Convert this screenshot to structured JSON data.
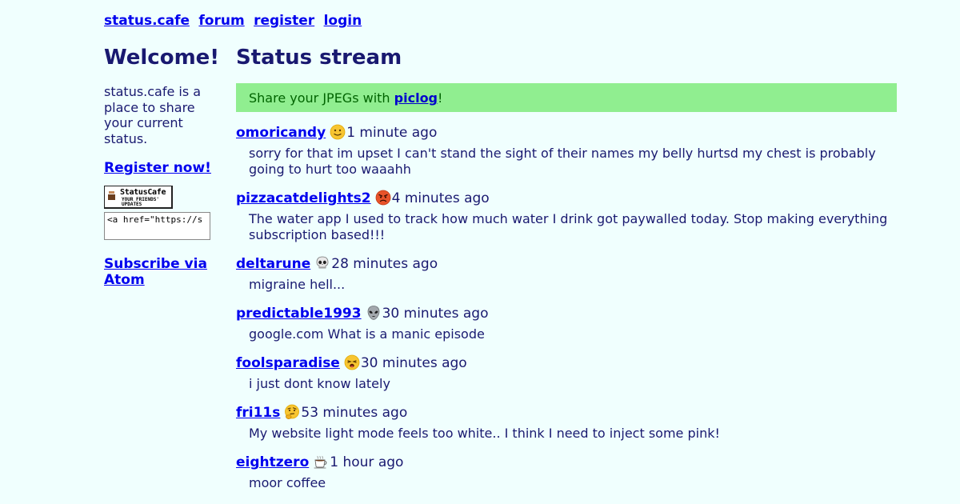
{
  "nav": {
    "site": "status.cafe",
    "forum": "forum",
    "register": "register",
    "login": "login"
  },
  "sidebar": {
    "welcome": "Welcome!",
    "intro": "status.cafe is a place to share your current status.",
    "register_now": "Register now!",
    "badge_title": "StatusCafe",
    "badge_subtitle": "YOUR FRIENDS' UPDATES",
    "embed_code": "<a href=\"https://s",
    "subscribe": "Subscribe via Atom"
  },
  "main": {
    "title": "Status stream",
    "banner_text": "Share your JPEGs with ",
    "banner_link": "piclog",
    "banner_suffix": "!",
    "banner_color": "#90ee90",
    "entries": [
      {
        "user": "omoricandy",
        "emoji": "slightly-smiling-face-icon",
        "time": "1 minute ago",
        "text": "sorry for that im upset I can't stand the sight of their names my belly hurtsd my chest is probably going to hurt too waaahh"
      },
      {
        "user": "pizzacatdelights2",
        "emoji": "angry-face-icon",
        "time": "4 minutes ago",
        "text": "The water app I used to track how much water I drink got paywalled today. Stop making everything subscription based!!!"
      },
      {
        "user": "deltarune",
        "emoji": "skull-icon",
        "time": "28 minutes ago",
        "text": "migraine hell..."
      },
      {
        "user": "predictable1993",
        "emoji": "alien-icon",
        "time": "30 minutes ago",
        "text": "google.com What is a manic episode"
      },
      {
        "user": "foolsparadise",
        "emoji": "tired-face-icon",
        "time": "30 minutes ago",
        "text": "i just dont know lately"
      },
      {
        "user": "fri11s",
        "emoji": "thinking-face-icon",
        "time": "53 minutes ago",
        "text": "My website light mode feels too white.. I think I need to inject some pink!"
      },
      {
        "user": "eightzero",
        "emoji": "coffee-icon",
        "time": "1 hour ago",
        "text": "moor coffee"
      }
    ]
  }
}
